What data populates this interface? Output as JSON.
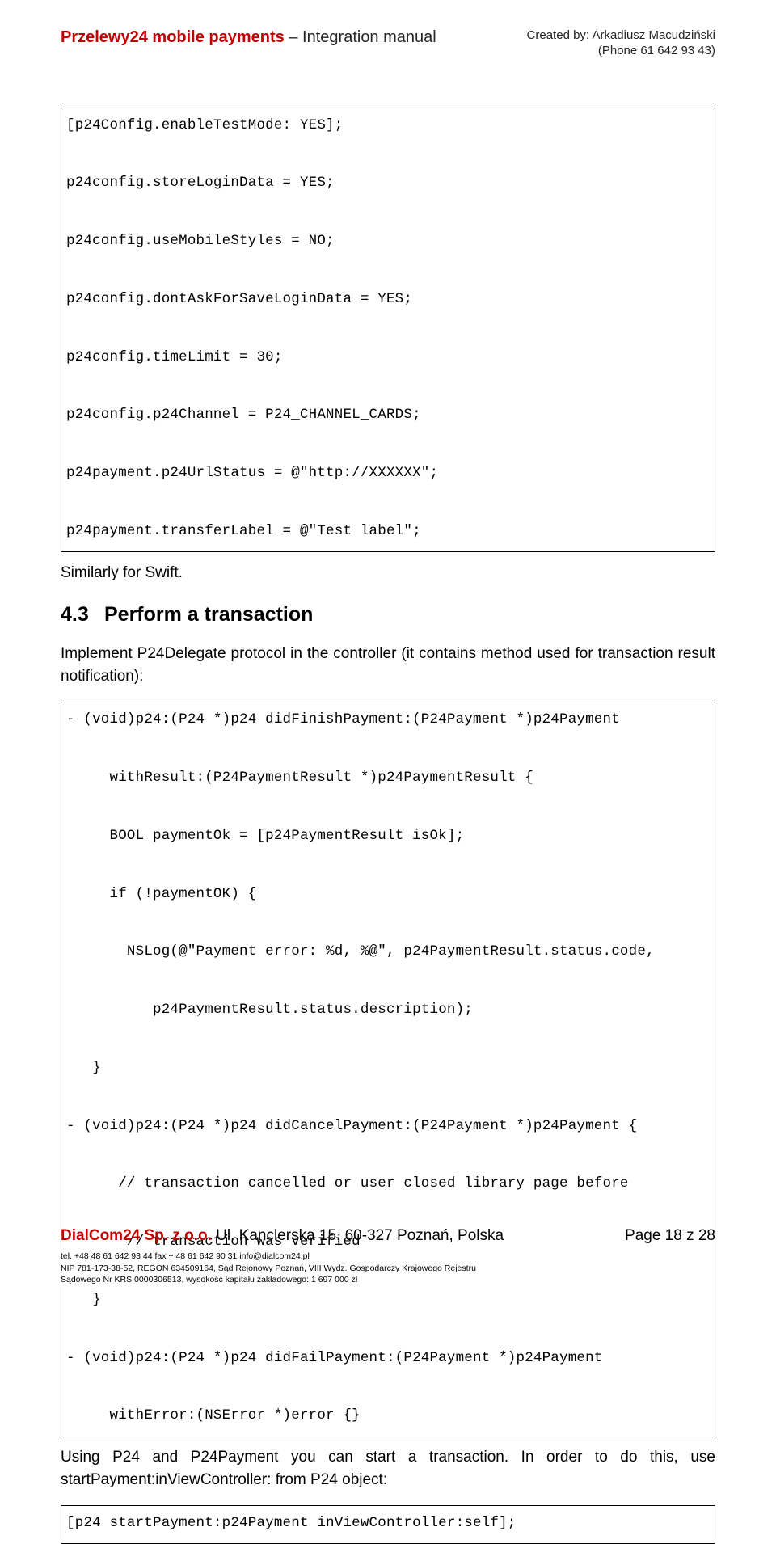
{
  "header": {
    "title_bold": "Przelewy24 mobile payments",
    "title_sep": " – ",
    "title_thin": "Integration manual",
    "created_by_label": "Created by: ",
    "created_by_name": "Arkadiusz Macudziński",
    "phone_label": "(Phone ",
    "phone_number": "61 642 93 43",
    "phone_close": ")"
  },
  "code1": "[p24Config.enableTestMode: YES];\n\np24config.storeLoginData = YES;\n\np24config.useMobileStyles = NO;\n\np24config.dontAskForSaveLoginData = YES;\n\np24config.timeLimit = 30;\n\np24config.p24Channel = P24_CHANNEL_CARDS;\n\np24payment.p24UrlStatus = @\"http://XXXXXX\";\n\np24payment.transferLabel = @\"Test label\";",
  "para_swift": "Similarly for Swift.",
  "section": {
    "num": "4.3",
    "title": "Perform a transaction"
  },
  "para_impl": "Implement P24Delegate protocol in the controller (it contains method used for transaction result notification):",
  "code2": "- (void)p24:(P24 *)p24 didFinishPayment:(P24Payment *)p24Payment\n\n     withResult:(P24PaymentResult *)p24PaymentResult {\n\n     BOOL paymentOk = [p24PaymentResult isOk];\n\n     if (!paymentOK) {\n\n       NSLog(@\"Payment error: %d, %@\", p24PaymentResult.status.code,\n\n          p24PaymentResult.status.description);\n\n   }\n\n- (void)p24:(P24 *)p24 didCancelPayment:(P24Payment *)p24Payment {\n\n      // transaction cancelled or user closed library page before\n\n       // transaction was verified\n\n   }\n\n- (void)p24:(P24 *)p24 didFailPayment:(P24Payment *)p24Payment\n\n     withError:(NSError *)error {}",
  "para_using": "Using P24 and P24Payment you can start a transaction. In order to do this, use startPayment:inViewController: from P24 object:",
  "code3": "[p24 startPayment:p24Payment inViewController:self];",
  "footer": {
    "company_bold": "DialCom24 Sp. z o.o.",
    "company_addr": " Ul. Kanclerska 15, 60-327 Poznań, Polska",
    "page": "Page 18 z 28",
    "legal1": "tel. +48 48 61 642 93 44 fax + 48 61 642 90 31 info@dialcom24.pl",
    "legal2": "NIP 781-173-38-52, REGON 634509164, Sąd Rejonowy Poznań, VIII Wydz. Gospodarczy Krajowego Rejestru",
    "legal3": "Sądowego Nr KRS 0000306513, wysokość kapitału zakładowego: 1 697 000 zł"
  }
}
